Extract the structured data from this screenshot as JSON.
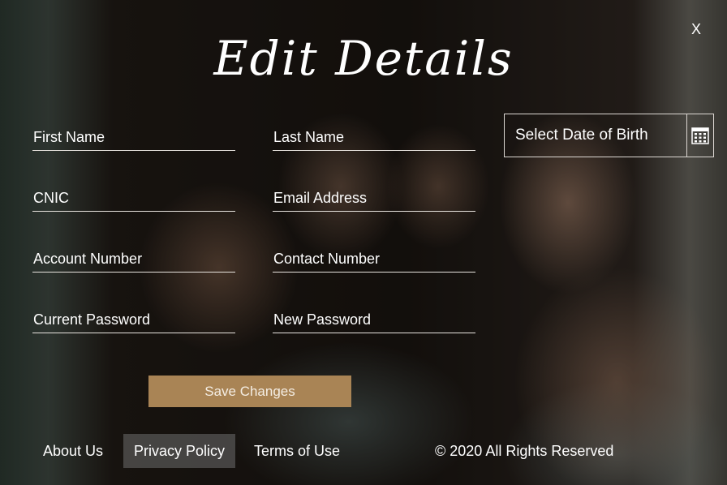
{
  "dialog": {
    "title": "Edit Details",
    "close_label": "X"
  },
  "form": {
    "first_name": {
      "placeholder": "First Name",
      "value": ""
    },
    "last_name": {
      "placeholder": "Last Name",
      "value": ""
    },
    "cnic": {
      "placeholder": "CNIC",
      "value": ""
    },
    "email": {
      "placeholder": "Email Address",
      "value": ""
    },
    "account_number": {
      "placeholder": "Account Number",
      "value": ""
    },
    "contact_number": {
      "placeholder": "Contact Number",
      "value": ""
    },
    "current_password": {
      "placeholder": "Current Password",
      "value": ""
    },
    "new_password": {
      "placeholder": "New Password",
      "value": ""
    },
    "dob": {
      "placeholder": "Select Date of Birth",
      "icon": "calendar-icon"
    },
    "save_label": "Save Changes",
    "accent_color": "#a98455"
  },
  "footer": {
    "links": [
      {
        "label": "About Us"
      },
      {
        "label": "Privacy Policy",
        "active": true
      },
      {
        "label": "Terms of Use"
      }
    ],
    "copyright": "© 2020 All Rights Reserved"
  }
}
